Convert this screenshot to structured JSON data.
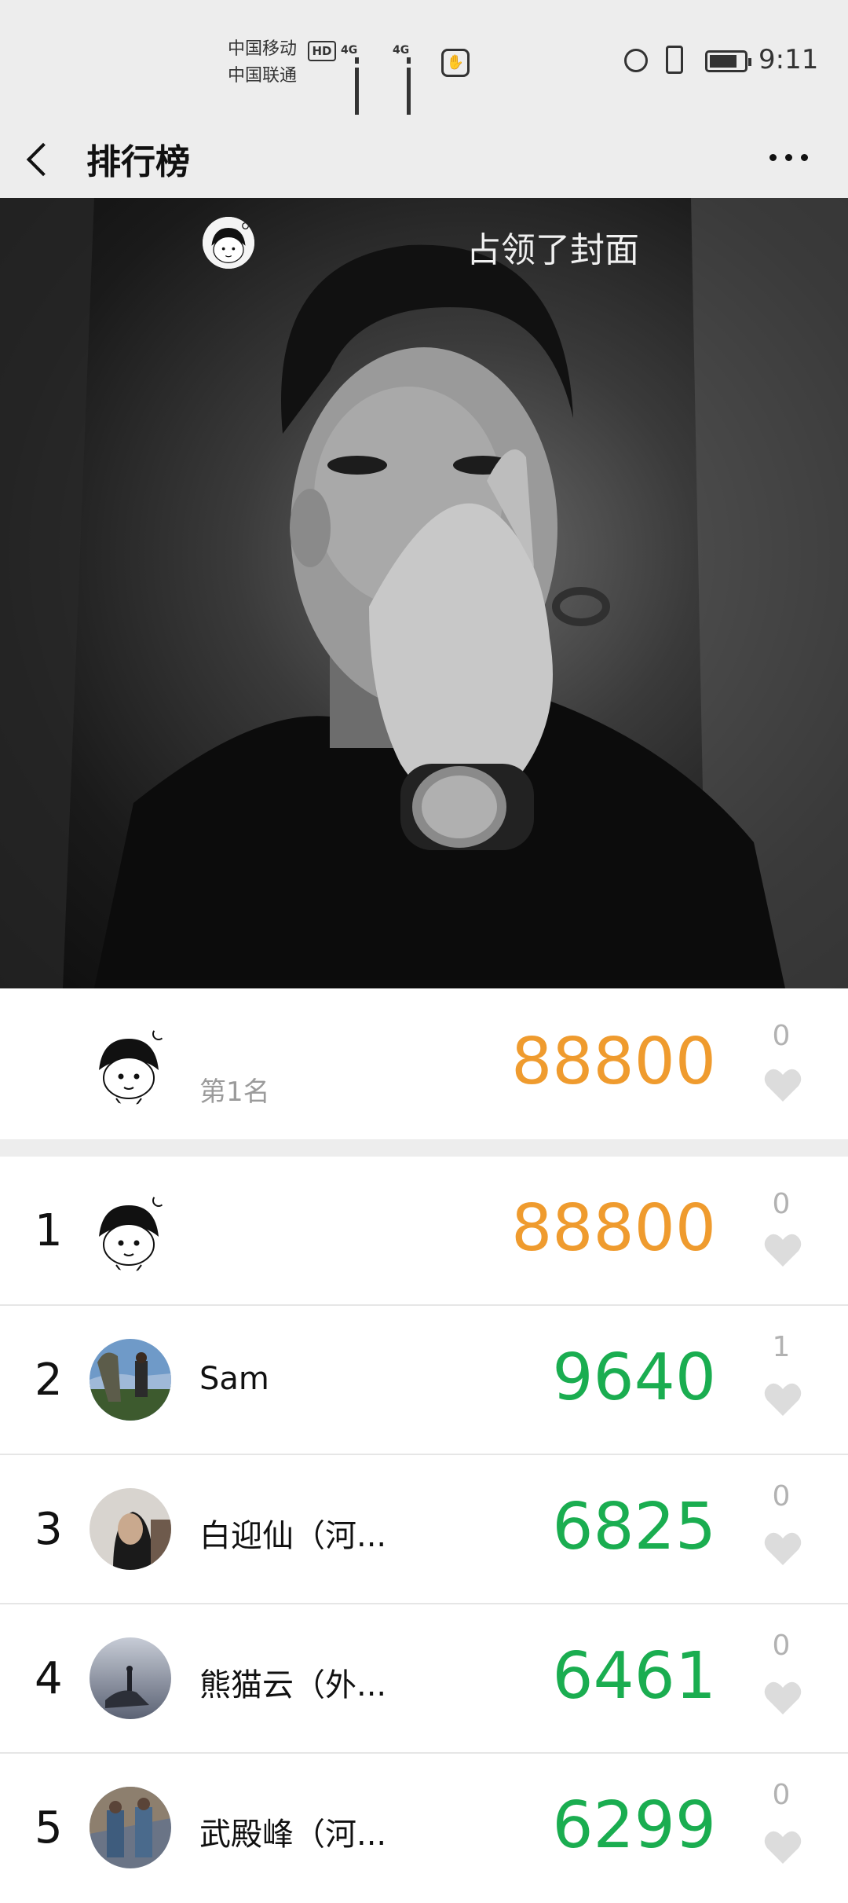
{
  "status_bar": {
    "carrier_1": "中国移动",
    "carrier_2": "中国联通",
    "hd_badge": "HD",
    "signal_1_label": "4G",
    "signal_2_label": "4G",
    "time": "9:11",
    "battery_level": 0.8
  },
  "nav": {
    "title": "排行榜"
  },
  "cover": {
    "caption": "占领了封面"
  },
  "my_rank": {
    "rank_label": "第1名",
    "steps": "88800",
    "likes": "0"
  },
  "leaderboard": [
    {
      "rank": "1",
      "name": "",
      "steps": "88800",
      "likes": "0"
    },
    {
      "rank": "2",
      "name": "Sam",
      "steps": "9640",
      "likes": "1"
    },
    {
      "rank": "3",
      "name": "白迎仙（河...",
      "steps": "6825",
      "likes": "0"
    },
    {
      "rank": "4",
      "name": "熊猫云（外...",
      "steps": "6461",
      "likes": "0"
    },
    {
      "rank": "5",
      "name": "武殿峰（河...",
      "steps": "6299",
      "likes": "0"
    }
  ],
  "colors": {
    "top_steps": "#ef9b2e",
    "other_steps": "#1aad50",
    "heart": "#dcdcdc"
  }
}
